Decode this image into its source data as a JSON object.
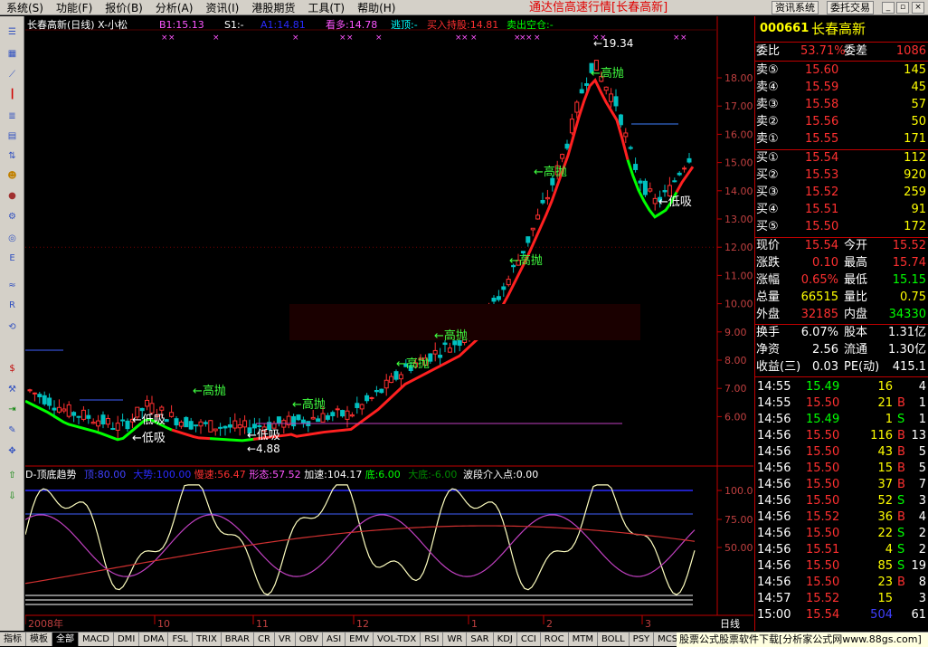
{
  "menu": [
    "系统(S)",
    "功能(F)",
    "报价(B)",
    "分析(A)",
    "资讯(I)",
    "港股期货",
    "工具(T)",
    "帮助(H)"
  ],
  "app_title": "通达信高速行情[长春高新]",
  "buttons": {
    "news": "资讯系统",
    "trade": "委托交易"
  },
  "chart": {
    "title": "长春高新(日线) X-小松",
    "indicators": [
      {
        "text": "B1:15.13",
        "color": "#ff55ff"
      },
      {
        "text": "S1:-",
        "color": "#ffffff"
      },
      {
        "text": "A1:14.81",
        "color": "#2a2aff"
      },
      {
        "text": "看多:14.78",
        "color": "#ff55ff"
      },
      {
        "text": "逃顶:-",
        "color": "#00ffff"
      },
      {
        "text": "买入持股:14.81",
        "color": "#ff3030"
      },
      {
        "text": "卖出空仓:-",
        "color": "#00ff00"
      }
    ],
    "price_axis": [
      "18.00",
      "17.00",
      "16.00",
      "15.00",
      "14.00",
      "13.00",
      "12.00",
      "11.00",
      "10.00",
      "9.00",
      "8.00",
      "7.00",
      "6.00"
    ],
    "osc_axis": [
      "100.0",
      "75.00",
      "50.00"
    ],
    "signals": {
      "high": "高抛",
      "low": "低吸",
      "peak": "19.34",
      "bottom": "4.88"
    },
    "osc": {
      "name": "D-顶底趋势",
      "values": [
        {
          "text": "顶:80.00",
          "color": "#4040ff"
        },
        {
          "text": "大势:100.00",
          "color": "#2a2aff"
        },
        {
          "text": "慢速:56.47",
          "color": "#ff3030"
        },
        {
          "text": "形态:57.52",
          "color": "#ff55ff"
        },
        {
          "text": "加速:104.17",
          "color": "#ffffff"
        },
        {
          "text": "底:6.00",
          "color": "#00ff00"
        },
        {
          "text": "大底:-6.00",
          "color": "#008800"
        },
        {
          "text": "波段介入点:0.00",
          "color": "#ffffff"
        }
      ]
    },
    "x_labels": [
      "2008年",
      "10",
      "11",
      "12",
      "1",
      "2",
      "3"
    ],
    "period": "日线"
  },
  "quote": {
    "code": "000661",
    "name": "长春高新",
    "weibi_label": "委比",
    "weibi": "53.71%",
    "weicha_label": "委差",
    "weicha": "1086",
    "sell": [
      {
        "label": "卖⑤",
        "price": "15.60",
        "vol": "145"
      },
      {
        "label": "卖④",
        "price": "15.59",
        "vol": "45"
      },
      {
        "label": "卖③",
        "price": "15.58",
        "vol": "57"
      },
      {
        "label": "卖②",
        "price": "15.56",
        "vol": "50"
      },
      {
        "label": "卖①",
        "price": "15.55",
        "vol": "171"
      }
    ],
    "buy": [
      {
        "label": "买①",
        "price": "15.54",
        "vol": "112"
      },
      {
        "label": "买②",
        "price": "15.53",
        "vol": "920"
      },
      {
        "label": "买③",
        "price": "15.52",
        "vol": "259"
      },
      {
        "label": "买④",
        "price": "15.51",
        "vol": "91"
      },
      {
        "label": "买⑤",
        "price": "15.50",
        "vol": "172"
      }
    ],
    "stats": [
      {
        "l1": "现价",
        "v1": "15.54",
        "c1": "#ff3030",
        "l2": "今开",
        "v2": "15.52",
        "c2": "#ff3030"
      },
      {
        "l1": "涨跌",
        "v1": "0.10",
        "c1": "#ff3030",
        "l2": "最高",
        "v2": "15.74",
        "c2": "#ff3030"
      },
      {
        "l1": "涨幅",
        "v1": "0.65%",
        "c1": "#ff3030",
        "l2": "最低",
        "v2": "15.15",
        "c2": "#00ff00"
      },
      {
        "l1": "总量",
        "v1": "66515",
        "c1": "#ffff00",
        "l2": "量比",
        "v2": "0.75",
        "c2": "#ffff00"
      },
      {
        "l1": "外盘",
        "v1": "32185",
        "c1": "#ff3030",
        "l2": "内盘",
        "v2": "34330",
        "c2": "#00ff00"
      }
    ],
    "stats2": [
      {
        "l1": "换手",
        "v1": "6.07%",
        "c1": "#ffffff",
        "l2": "股本",
        "v2": "1.31亿",
        "c2": "#ffffff"
      },
      {
        "l1": "净资",
        "v1": "2.56",
        "c1": "#ffffff",
        "l2": "流通",
        "v2": "1.30亿",
        "c2": "#ffffff"
      },
      {
        "l1": "收益(三)",
        "v1": "0.03",
        "c1": "#ffffff",
        "l2": "PE(动)",
        "v2": "415.1",
        "c2": "#ffffff"
      }
    ],
    "ticks": [
      {
        "t": "14:55",
        "p": "15.49",
        "pc": "#00ff00",
        "v": "16",
        "s": "",
        "n": "4"
      },
      {
        "t": "14:55",
        "p": "15.50",
        "pc": "#ff3030",
        "v": "21",
        "s": "B",
        "n": "1"
      },
      {
        "t": "14:56",
        "p": "15.49",
        "pc": "#00ff00",
        "v": "1",
        "s": "S",
        "n": "1"
      },
      {
        "t": "14:56",
        "p": "15.50",
        "pc": "#ff3030",
        "v": "116",
        "s": "B",
        "n": "13"
      },
      {
        "t": "14:56",
        "p": "15.50",
        "pc": "#ff3030",
        "v": "43",
        "s": "B",
        "n": "5"
      },
      {
        "t": "14:56",
        "p": "15.50",
        "pc": "#ff3030",
        "v": "15",
        "s": "B",
        "n": "5"
      },
      {
        "t": "14:56",
        "p": "15.50",
        "pc": "#ff3030",
        "v": "37",
        "s": "B",
        "n": "7"
      },
      {
        "t": "14:56",
        "p": "15.50",
        "pc": "#ff3030",
        "v": "52",
        "s": "S",
        "n": "3"
      },
      {
        "t": "14:56",
        "p": "15.52",
        "pc": "#ff3030",
        "v": "36",
        "s": "B",
        "n": "4"
      },
      {
        "t": "14:56",
        "p": "15.50",
        "pc": "#ff3030",
        "v": "22",
        "s": "S",
        "n": "2"
      },
      {
        "t": "14:56",
        "p": "15.51",
        "pc": "#ff3030",
        "v": "4",
        "s": "S",
        "n": "2"
      },
      {
        "t": "14:56",
        "p": "15.50",
        "pc": "#ff3030",
        "v": "85",
        "s": "S",
        "n": "19"
      },
      {
        "t": "14:56",
        "p": "15.50",
        "pc": "#ff3030",
        "v": "23",
        "s": "B",
        "n": "8"
      },
      {
        "t": "14:57",
        "p": "15.52",
        "pc": "#ff3030",
        "v": "15",
        "s": "",
        "n": "3"
      },
      {
        "t": "15:00",
        "p": "15.54",
        "pc": "#ff3030",
        "v": "504",
        "s": "",
        "n": "61"
      }
    ]
  },
  "bottom_tabs": [
    "指标",
    "模板",
    "全部",
    "MACD",
    "DMI",
    "DMA",
    "FSL",
    "TRIX",
    "BRAR",
    "CR",
    "VR",
    "OBV",
    "ASI",
    "EMV",
    "VOL-TDX",
    "RSI",
    "WR",
    "SAR",
    "KDJ",
    "CCI",
    "ROC",
    "MTM",
    "BOLL",
    "PSY",
    "MCST"
  ],
  "status": "股票公式股票软件下载[分析家公式网www.88gs.com]"
}
